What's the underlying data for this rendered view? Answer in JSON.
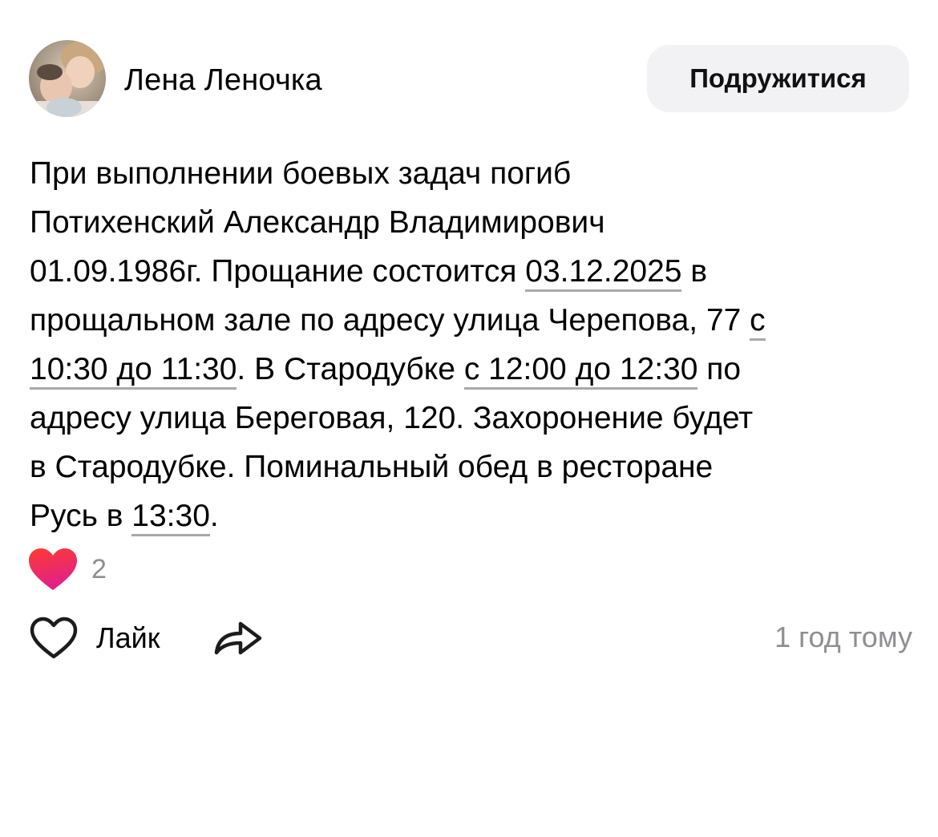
{
  "author": {
    "name": "Лена Леночка",
    "avatar_icon": "avatar-photo"
  },
  "befriend_button_label": "Подружитися",
  "post": {
    "lines": [
      [
        {
          "text": "При выполнении боевых задач погиб"
        }
      ],
      [
        {
          "text": "Потихенский Александр Владимирович"
        }
      ],
      [
        {
          "text": "01.09.1986г. Прощание состоится "
        },
        {
          "text": "03.12.2025",
          "link": true
        },
        {
          "text": " в"
        }
      ],
      [
        {
          "text": "прощальном зале по адресу улица Черепова, 77 "
        },
        {
          "text": "с",
          "link": true
        }
      ],
      [
        {
          "text": "10:30 до 11:30",
          "link": true
        },
        {
          "text": ". В Стародубке "
        },
        {
          "text": "с 12:00 до 12:30",
          "link": true
        },
        {
          "text": " по"
        }
      ],
      [
        {
          "text": "адресу улица Береговая, 120. Захоронение будет"
        }
      ],
      [
        {
          "text": "в Стародубке. Поминальный обед в ресторане"
        }
      ],
      [
        {
          "text": "Русь в "
        },
        {
          "text": "13:30",
          "link": true
        },
        {
          "text": "."
        }
      ]
    ]
  },
  "reactions": {
    "icon": "heart-reaction-icon",
    "count": "2"
  },
  "actions": {
    "like_label": "Лайк",
    "like_icon": "heart-outline-icon",
    "share_icon": "share-arrow-icon",
    "timestamp": "1 год тому"
  },
  "colors": {
    "text": "#000000",
    "muted": "#8e8e93",
    "button_bg": "#f2f2f4",
    "heart_gradient_top": "#ff3b30",
    "heart_gradient_bottom": "#e0208a"
  }
}
